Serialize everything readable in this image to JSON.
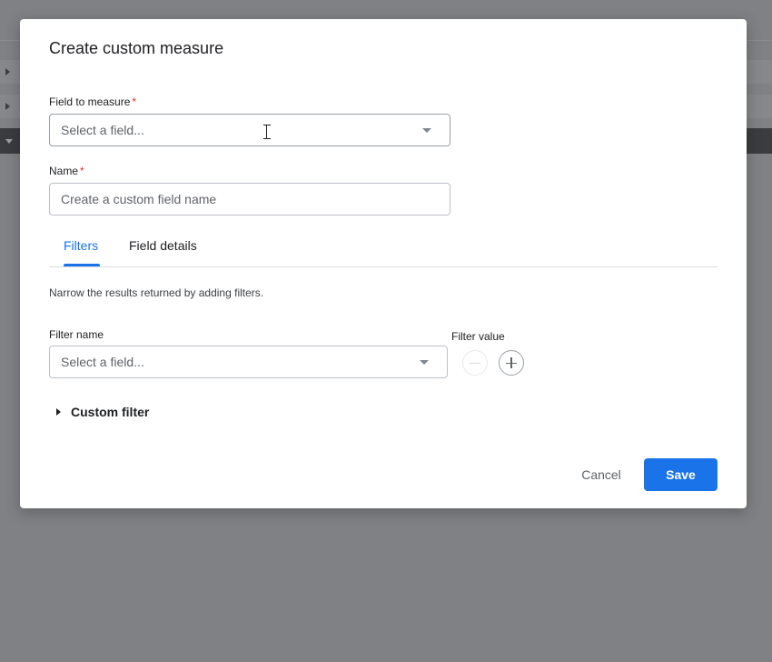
{
  "dialog": {
    "title": "Create custom measure",
    "field_to_measure": {
      "label": "Field to measure",
      "required_mark": "*",
      "placeholder": "Select a field..."
    },
    "name": {
      "label": "Name",
      "required_mark": "*",
      "placeholder": "Create a custom field name"
    },
    "tabs": [
      {
        "label": "Filters",
        "active": true
      },
      {
        "label": "Field details",
        "active": false
      }
    ],
    "filters": {
      "description": "Narrow the results returned by adding filters.",
      "filter_name_label": "Filter name",
      "filter_name_placeholder": "Select a field...",
      "filter_value_label": "Filter value",
      "remove_icon": "minus-icon",
      "add_icon": "plus-icon"
    },
    "custom_filter_label": "Custom filter",
    "actions": {
      "cancel": "Cancel",
      "save": "Save"
    }
  },
  "colors": {
    "accent": "#1a73e8",
    "required": "#d93025",
    "overlay": "#7f8184"
  }
}
